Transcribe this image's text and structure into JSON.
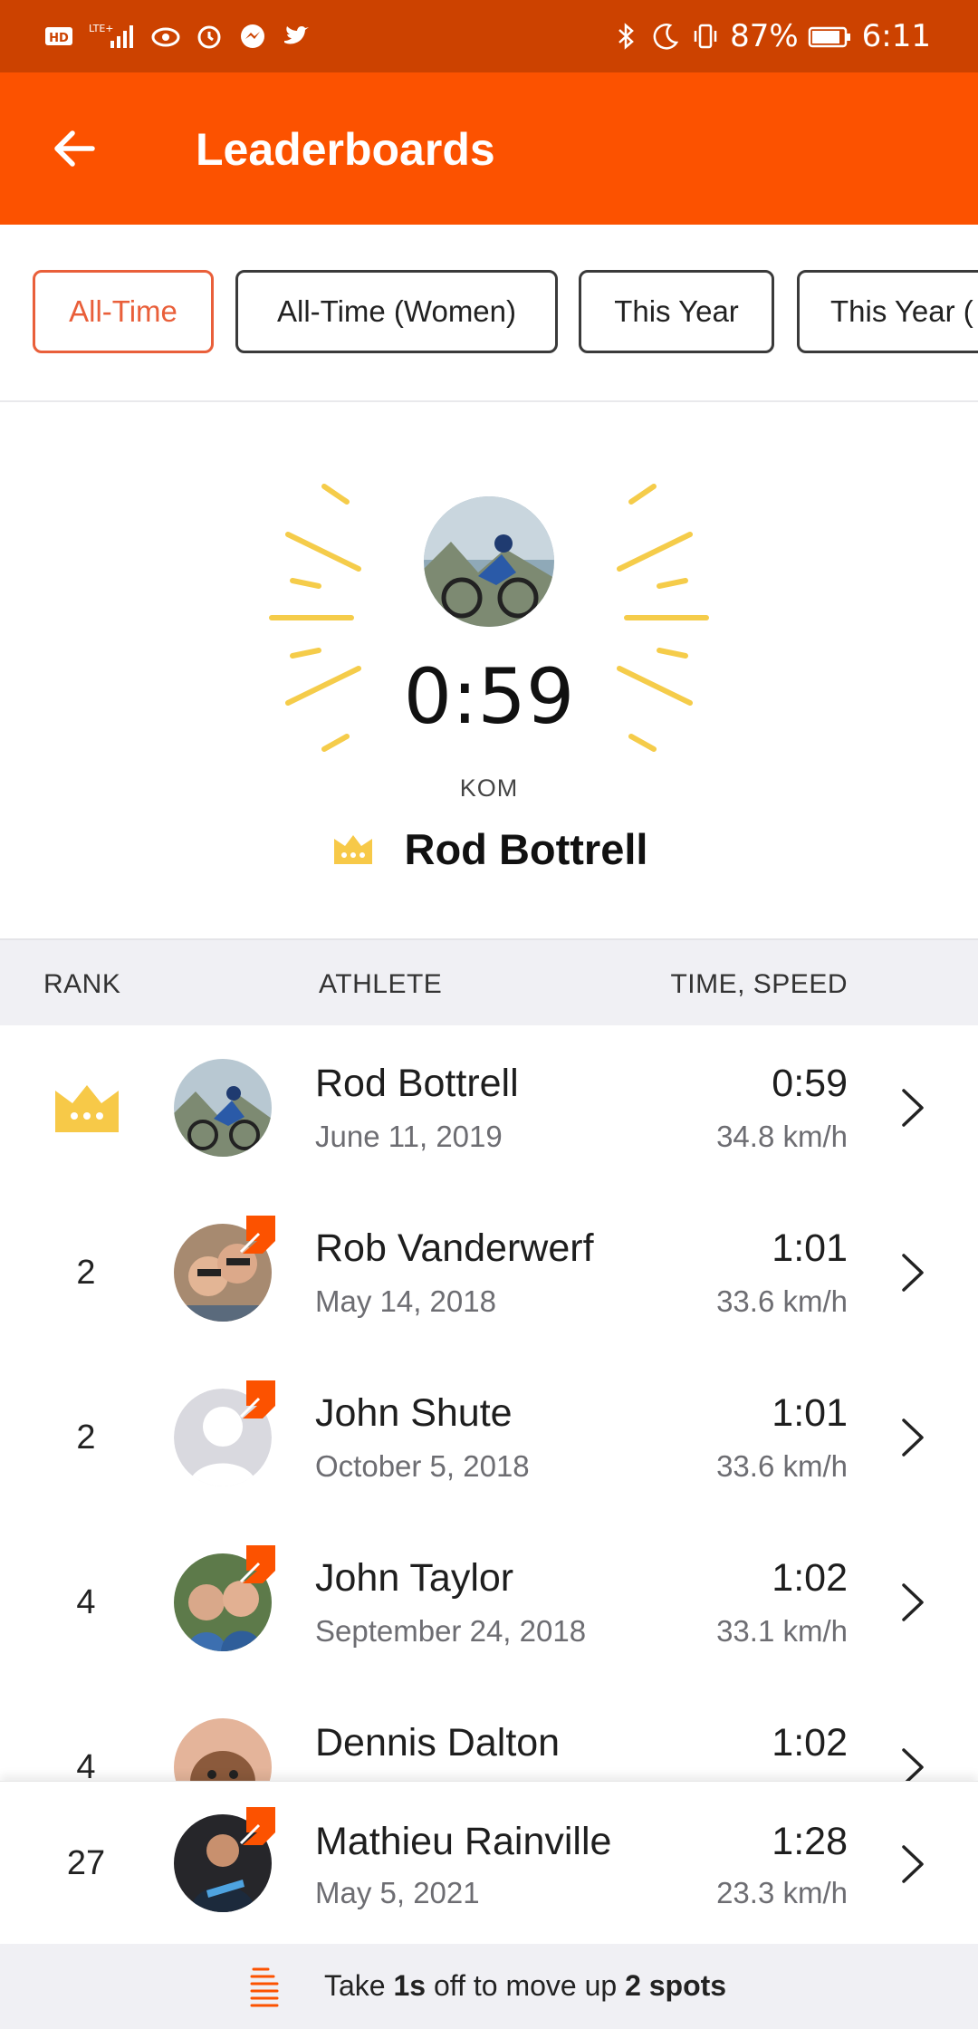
{
  "status_bar": {
    "left_icons": [
      "hd-icon",
      "lte-signal-icon",
      "eye-icon",
      "alarm-icon",
      "messenger-icon",
      "twitter-icon"
    ],
    "battery": "87%",
    "time": "6:11"
  },
  "app_bar": {
    "title": "Leaderboards"
  },
  "tabs": [
    {
      "label": "All-Time",
      "active": true
    },
    {
      "label": "All-Time (Women)",
      "active": false
    },
    {
      "label": "This Year",
      "active": false
    },
    {
      "label": "This Year (",
      "active": false
    }
  ],
  "hero": {
    "time": "0:59",
    "label": "KOM",
    "name": "Rod Bottrell"
  },
  "table": {
    "headers": {
      "rank": "RANK",
      "athlete": "ATHLETE",
      "time_speed": "TIME, SPEED"
    },
    "rows": [
      {
        "rank": "",
        "crown": true,
        "name": "Rod Bottrell",
        "date": "June 11, 2019",
        "time": "0:59",
        "speed": "34.8 km/h",
        "badge": false,
        "avatar_color": "#6a8fa8"
      },
      {
        "rank": "2",
        "crown": false,
        "name": "Rob Vanderwerf",
        "date": "May 14, 2018",
        "time": "1:01",
        "speed": "33.6 km/h",
        "badge": true,
        "avatar_color": "#8a6a52"
      },
      {
        "rank": "2",
        "crown": false,
        "name": "John Shute",
        "date": "October 5, 2018",
        "time": "1:01",
        "speed": "33.6 km/h",
        "badge": true,
        "avatar_color": "#dadae0"
      },
      {
        "rank": "4",
        "crown": false,
        "name": "John Taylor",
        "date": "September 24, 2018",
        "time": "1:02",
        "speed": "33.1 km/h",
        "badge": true,
        "avatar_color": "#4c6a3e"
      },
      {
        "rank": "4",
        "crown": false,
        "name": "Dennis Dalton",
        "date": "",
        "time": "1:02",
        "speed": "",
        "badge": false,
        "avatar_color": "#c27a54"
      }
    ],
    "pinned_row": {
      "rank": "27",
      "name": "Mathieu Rainville",
      "date": "May 5, 2021",
      "time": "1:28",
      "speed": "23.3 km/h",
      "badge": true,
      "avatar_color": "#2a2a2e"
    }
  },
  "footer": {
    "prefix": "Take ",
    "amount": "1s",
    "middle": " off to move up ",
    "spots": "2 spots"
  },
  "colors": {
    "accent": "#fc5200",
    "status_bar": "#cc4200",
    "crown": "#f7c948",
    "rays": "#f5cc4a"
  }
}
